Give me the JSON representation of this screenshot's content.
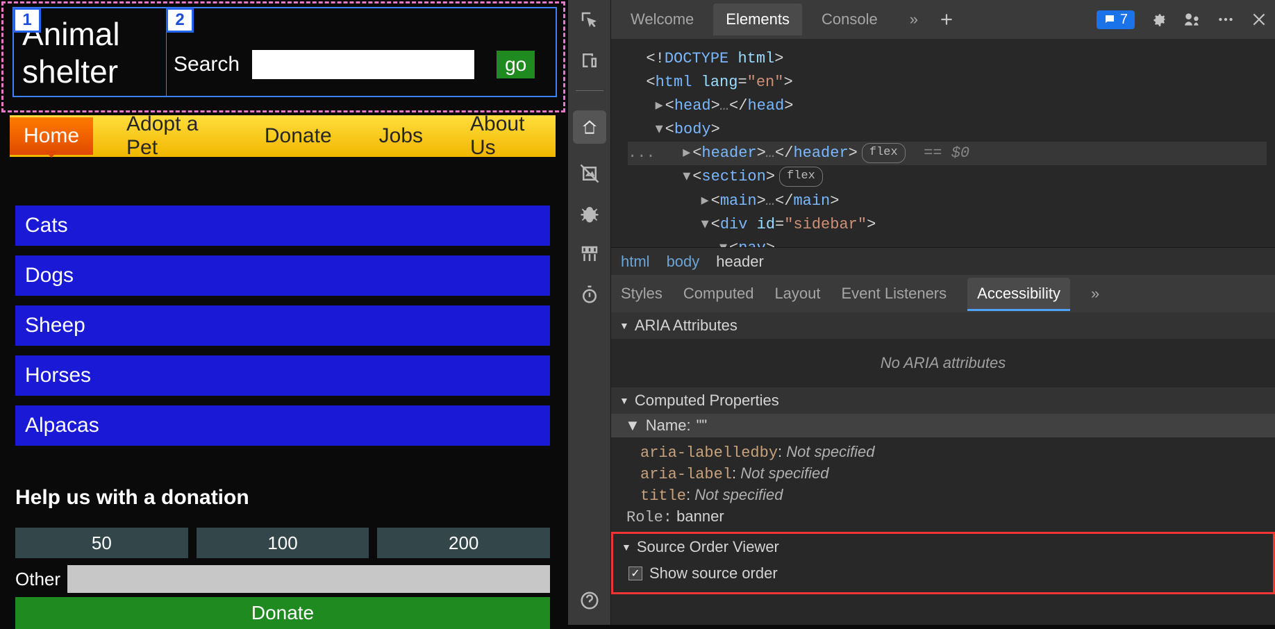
{
  "page": {
    "title": "Animal shelter",
    "search_label": "Search",
    "go_label": "go",
    "nav": [
      "Home",
      "Adopt a Pet",
      "Donate",
      "Jobs",
      "About Us"
    ],
    "nav_active": "Home",
    "categories": [
      "Cats",
      "Dogs",
      "Sheep",
      "Horses",
      "Alpacas"
    ],
    "donation_heading": "Help us with a donation",
    "donation_amounts": [
      "50",
      "100",
      "200"
    ],
    "other_label": "Other",
    "donate_label": "Donate",
    "src_badges": [
      "1",
      "2"
    ]
  },
  "devtools": {
    "tabs": [
      "Welcome",
      "Elements",
      "Console"
    ],
    "active_tab": "Elements",
    "more_tabs_icon": "»",
    "issues_count": "7",
    "dom": {
      "line0": "<!DOCTYPE html>",
      "html_open": "<html lang=\"en\">",
      "head": "<head>…</head>",
      "body_open": "<body>",
      "header": "<header>…</header>",
      "header_badge": "flex",
      "header_eq": "== $0",
      "section_open": "<section>",
      "section_badge": "flex",
      "main": "<main>…</main>",
      "sidebar_open": "<div id=\"sidebar\">",
      "nav_open": "<nav>",
      "ellipsis": "..."
    },
    "breadcrumb": [
      "html",
      "body",
      "header"
    ],
    "subtabs": [
      "Styles",
      "Computed",
      "Layout",
      "Event Listeners",
      "Accessibility"
    ],
    "active_subtab": "Accessibility",
    "a11y": {
      "aria_attrs_header": "ARIA Attributes",
      "no_aria": "No ARIA attributes",
      "computed_props_header": "Computed Properties",
      "name_label": "Name:",
      "name_value": "\"\"",
      "labelledby_key": "aria-labelledby",
      "label_key": "aria-label",
      "title_key": "title",
      "not_specified": "Not specified",
      "role_key": "Role:",
      "role_value": "banner",
      "source_order_header": "Source Order Viewer",
      "show_source_order": "Show source order"
    }
  }
}
